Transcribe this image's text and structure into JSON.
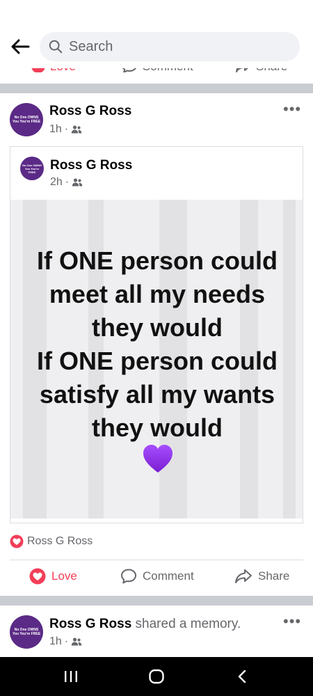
{
  "header": {
    "search_placeholder": "Search"
  },
  "previous_post_actions": {
    "love_label": "Love",
    "comment_label": "Comment",
    "share_label": "Share"
  },
  "post": {
    "author": "Ross G Ross",
    "time": "1h",
    "avatar_text": "No One OWNS You You're FREE",
    "shared": {
      "author": "Ross G Ross",
      "time": "2h",
      "quote_lines": [
        "If ONE person could",
        "meet all my needs",
        "they would",
        "If ONE person could",
        "satisfy all my wants",
        "they would"
      ],
      "emoji": "purple-heart"
    },
    "reaction_name": "Ross G Ross",
    "actions": {
      "love_label": "Love",
      "comment_label": "Comment",
      "share_label": "Share"
    }
  },
  "next_post": {
    "author": "Ross G Ross",
    "action_text": "shared a memory.",
    "time": "1h"
  },
  "colors": {
    "love": "#f33e58",
    "separator": "#c9ccd1",
    "secondary_text": "#65676b",
    "avatar": "#5b2a86",
    "emoji_heart": "#8a2be2"
  }
}
